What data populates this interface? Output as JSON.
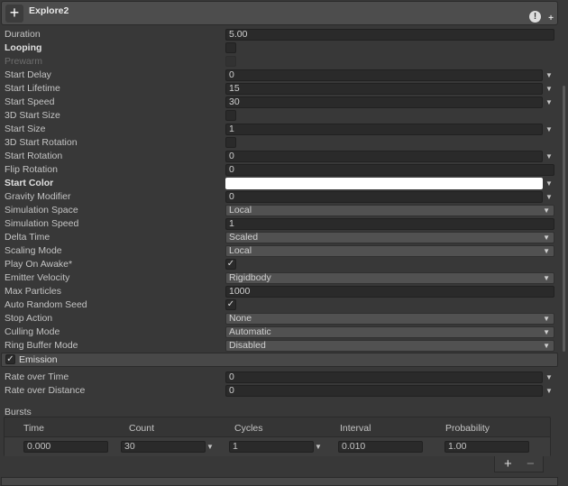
{
  "header": {
    "title": "Explore2",
    "icon": "plus-crosshair-icon",
    "help_icon": "help-icon",
    "add_icon": "plus-icon"
  },
  "main": {
    "rows": [
      {
        "label": "Duration",
        "value": "5.00",
        "kind": "field"
      },
      {
        "label": "Looping",
        "kind": "checkbox",
        "checked": false,
        "bold": true
      },
      {
        "label": "Prewarm",
        "kind": "checkbox",
        "checked": false,
        "disabled": true
      },
      {
        "label": "Start Delay",
        "value": "0",
        "kind": "curve"
      },
      {
        "label": "Start Lifetime",
        "value": "15",
        "kind": "curve"
      },
      {
        "label": "Start Speed",
        "value": "30",
        "kind": "curve"
      },
      {
        "label": "3D Start Size",
        "kind": "checkbox",
        "checked": false
      },
      {
        "label": "Start Size",
        "value": "1",
        "kind": "curve"
      },
      {
        "label": "3D Start Rotation",
        "kind": "checkbox",
        "checked": false
      },
      {
        "label": "Start Rotation",
        "value": "0",
        "kind": "curve"
      },
      {
        "label": "Flip Rotation",
        "value": "0",
        "kind": "field"
      },
      {
        "label": "Start Color",
        "kind": "color",
        "color": "#ffffff",
        "bold": true
      },
      {
        "label": "Gravity Modifier",
        "value": "0",
        "kind": "curve"
      },
      {
        "label": "Simulation Space",
        "value": "Local",
        "kind": "dropdown"
      },
      {
        "label": "Simulation Speed",
        "value": "1",
        "kind": "field"
      },
      {
        "label": "Delta Time",
        "value": "Scaled",
        "kind": "dropdown"
      },
      {
        "label": "Scaling Mode",
        "value": "Local",
        "kind": "dropdown"
      },
      {
        "label": "Play On Awake*",
        "kind": "checkbox",
        "checked": true
      },
      {
        "label": "Emitter Velocity",
        "value": "Rigidbody",
        "kind": "dropdown"
      },
      {
        "label": "Max Particles",
        "value": "1000",
        "kind": "field"
      },
      {
        "label": "Auto Random Seed",
        "kind": "checkbox",
        "checked": true
      },
      {
        "label": "Stop Action",
        "value": "None",
        "kind": "dropdown"
      },
      {
        "label": "Culling Mode",
        "value": "Automatic",
        "kind": "dropdown"
      },
      {
        "label": "Ring Buffer Mode",
        "value": "Disabled",
        "kind": "dropdown"
      }
    ]
  },
  "emission": {
    "title": "Emission",
    "enabled": true,
    "rate_over_time": {
      "label": "Rate over Time",
      "value": "0"
    },
    "rate_over_distance": {
      "label": "Rate over Distance",
      "value": "0"
    },
    "bursts_label": "Bursts",
    "columns": [
      "Time",
      "Count",
      "Cycles",
      "Interval",
      "Probability"
    ],
    "burst_row": [
      "0.000",
      "30",
      "1",
      "0.010",
      "1.00"
    ],
    "add_label": "+",
    "remove_label": "−"
  }
}
